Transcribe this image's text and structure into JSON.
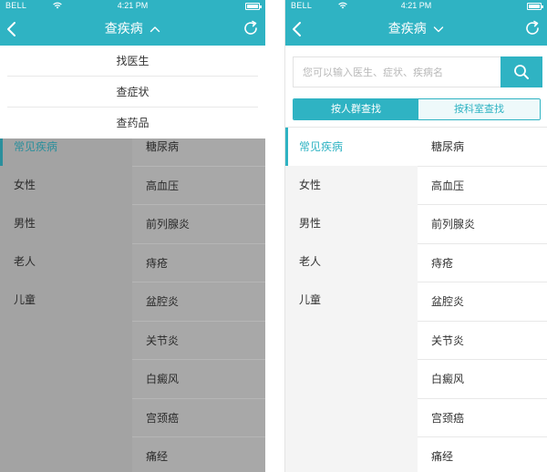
{
  "status_bar": {
    "carrier": "BELL",
    "time": "4:21 PM"
  },
  "nav": {
    "title": "查疾病"
  },
  "dropdown": {
    "items": [
      "找医生",
      "查症状",
      "查药品"
    ]
  },
  "search": {
    "placeholder": "您可以输入医生、症状、疾病名"
  },
  "segment": {
    "active": "按人群查找",
    "inactive": "按科室查找"
  },
  "categories": [
    "常见疾病",
    "女性",
    "男性",
    "老人",
    "儿童"
  ],
  "diseases": [
    "糖尿病",
    "高血压",
    "前列腺炎",
    "痔疮",
    "盆腔炎",
    "关节炎",
    "白癜风",
    "宫颈癌",
    "痛经"
  ],
  "colors": {
    "accent": "#2fb3c3",
    "overlay": "#a8a8a8"
  },
  "icons": {
    "back": "chevron-left-icon",
    "refresh": "refresh-icon",
    "search": "search-icon",
    "chevron_up": "chevron-up-icon",
    "chevron_down": "chevron-down-icon"
  }
}
